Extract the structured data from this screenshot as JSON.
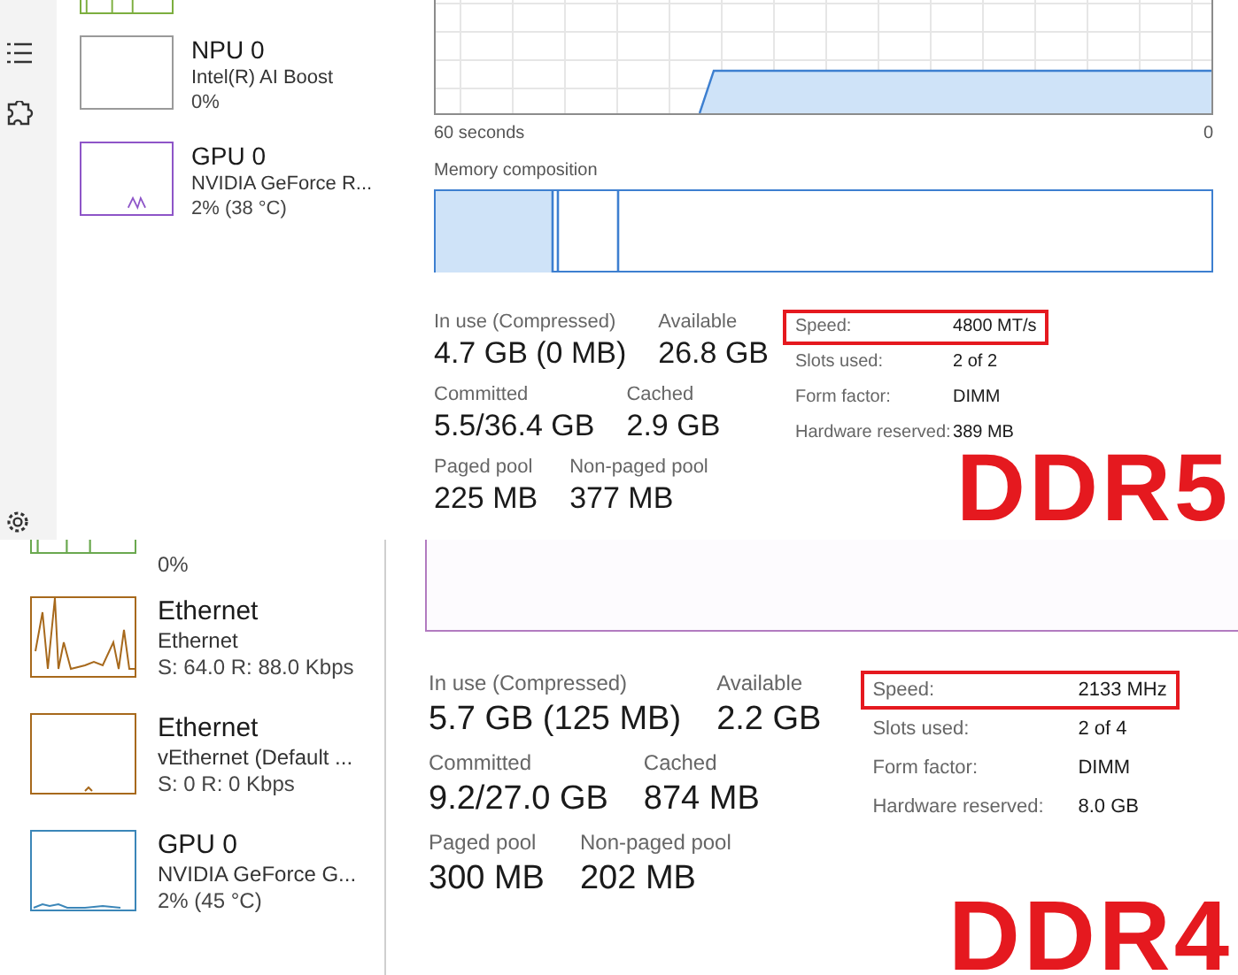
{
  "panels": [
    {
      "annotation": "DDR5",
      "sidebar": {
        "items": [
          {
            "color": "#7cae3e"
          },
          {
            "title": "NPU 0",
            "subtitle": "Intel(R) AI Boost",
            "detail": "0%",
            "color": "#9a9a9a"
          },
          {
            "title": "GPU 0",
            "subtitle": "NVIDIA GeForce R...",
            "detail": "2% (38 °C)",
            "color": "#8e55c8"
          }
        ]
      },
      "main": {
        "time_axis": {
          "start": "60 seconds",
          "end": "0"
        },
        "composition_title": "Memory composition",
        "stats": [
          [
            {
              "label": "In use (Compressed)",
              "value": "4.7 GB (0 MB)"
            },
            {
              "label": "Available",
              "value": "26.8 GB"
            }
          ],
          [
            {
              "label": "Committed",
              "value": "5.5/36.4 GB"
            },
            {
              "label": "Cached",
              "value": "2.9 GB"
            }
          ],
          [
            {
              "label": "Paged pool",
              "value": "225 MB"
            },
            {
              "label": "Non-paged pool",
              "value": "377 MB"
            }
          ]
        ],
        "specs": [
          {
            "label": "Speed:",
            "value": "4800 MT/s",
            "highlighted": true
          },
          {
            "label": "Slots used:",
            "value": "2 of 2",
            "highlighted": false
          },
          {
            "label": "Form factor:",
            "value": "DIMM",
            "highlighted": false
          },
          {
            "label": "Hardware reserved:",
            "value": "389 MB",
            "highlighted": false
          }
        ]
      }
    },
    {
      "annotation": "DDR4",
      "sidebar": {
        "items": [
          {
            "detail": "0%",
            "color": "#6aa84f"
          },
          {
            "title": "Ethernet",
            "subtitle": "Ethernet",
            "detail": "S: 64.0 R: 88.0 Kbps",
            "color": "#a7691c"
          },
          {
            "title": "Ethernet",
            "subtitle": "vEthernet (Default ...",
            "detail": "S: 0 R: 0 Kbps",
            "color": "#a7691c"
          },
          {
            "title": "GPU 0",
            "subtitle": "NVIDIA GeForce G...",
            "detail": "2% (45 °C)",
            "color": "#3b86b8"
          }
        ]
      },
      "main": {
        "stats": [
          [
            {
              "label": "In use (Compressed)",
              "value": "5.7 GB (125 MB)"
            },
            {
              "label": "Available",
              "value": "2.2 GB"
            }
          ],
          [
            {
              "label": "Committed",
              "value": "9.2/27.0 GB"
            },
            {
              "label": "Cached",
              "value": "874 MB"
            }
          ],
          [
            {
              "label": "Paged pool",
              "value": "300 MB"
            },
            {
              "label": "Non-paged pool",
              "value": "202 MB"
            }
          ]
        ],
        "specs": [
          {
            "label": "Speed:",
            "value": "2133 MHz",
            "highlighted": true
          },
          {
            "label": "Slots used:",
            "value": "2 of 4",
            "highlighted": false
          },
          {
            "label": "Form factor:",
            "value": "DIMM",
            "highlighted": false
          },
          {
            "label": "Hardware reserved:",
            "value": "8.0 GB",
            "highlighted": false
          }
        ]
      }
    }
  ]
}
